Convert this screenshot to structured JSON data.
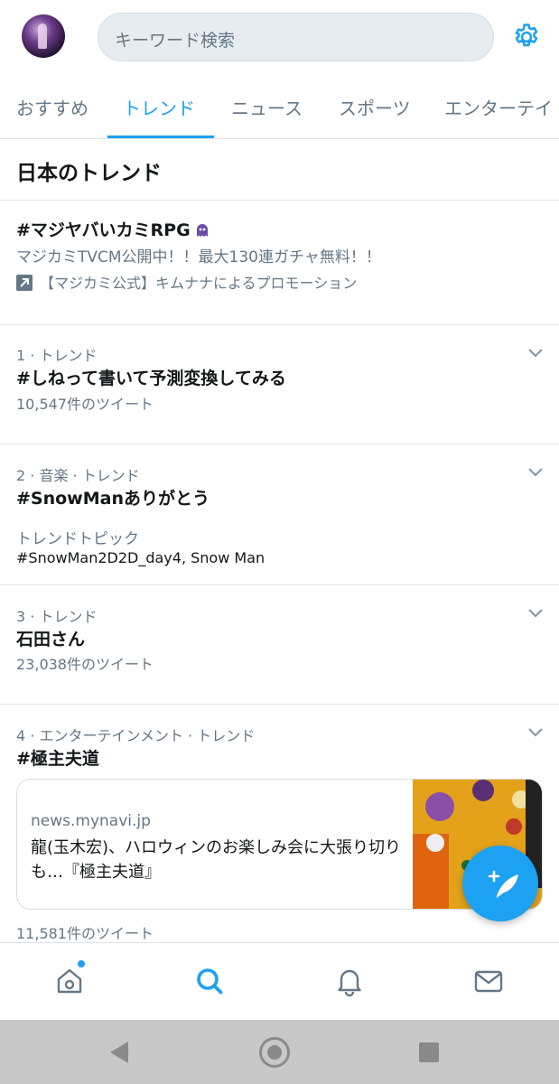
{
  "header": {
    "search_placeholder": "キーワード検索",
    "avatar_icon": "user-avatar",
    "settings_icon": "gear-icon",
    "accent_color": "#1da1f2"
  },
  "tabs": [
    {
      "label": "おすすめ",
      "active": false
    },
    {
      "label": "トレンド",
      "active": true
    },
    {
      "label": "ニュース",
      "active": false
    },
    {
      "label": "スポーツ",
      "active": false
    },
    {
      "label": "エンターテイ",
      "active": false
    }
  ],
  "section_title": "日本のトレンド",
  "promoted": {
    "name": "#マジヤバいカミRPG",
    "description": "マジカミTVCM公開中！！最大130連ガチャ無料！！",
    "promotion_text": "【マジカミ公式】キムナナによるプロモーション"
  },
  "trends": [
    {
      "meta": "1 · トレンド",
      "name": "#しねって書いて予測変換してみる",
      "count": "10,547件のツイート"
    },
    {
      "meta": "2 · 音楽 · トレンド",
      "name": "#SnowManありがとう",
      "topic_label": "トレンドトピック",
      "topics": "#SnowMan2D2D_day4, Snow Man"
    },
    {
      "meta": "3 · トレンド",
      "name": "石田さん",
      "count": "23,038件のツイート"
    },
    {
      "meta": "4 · エンターテインメント · トレンド",
      "name": "#極主夫道",
      "count": "11,581件のツイート"
    }
  ],
  "news_card": {
    "domain": "news.mynavi.jp",
    "title": "龍(玉木宏)、ハロウィンのお楽しみ会に大張り切りも…『極主夫道』"
  },
  "bottom_nav": [
    "home-icon",
    "search-icon",
    "bell-icon",
    "mail-icon"
  ],
  "system_nav": [
    "back-icon",
    "home-circle-icon",
    "recents-icon"
  ]
}
